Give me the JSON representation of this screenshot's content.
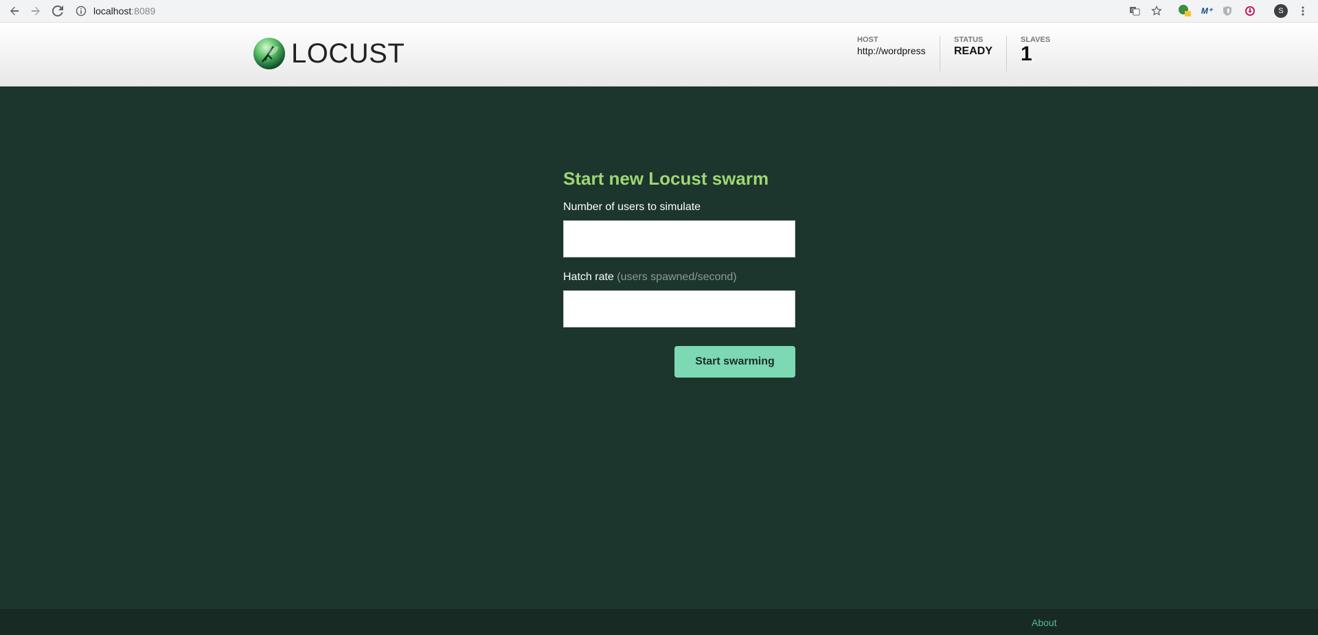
{
  "browser": {
    "url_host": "localhost",
    "url_port": ":8089",
    "profile_initial": "S"
  },
  "header": {
    "brand": "LOCUST",
    "host": {
      "label": "HOST",
      "value": "http://wordpress"
    },
    "status": {
      "label": "STATUS",
      "value": "READY"
    },
    "slaves": {
      "label": "SLAVES",
      "value": "1"
    }
  },
  "form": {
    "title": "Start new Locust swarm",
    "users_label": "Number of users to simulate",
    "users_value": "",
    "hatch_label": "Hatch rate",
    "hatch_hint": "(users spawned/second)",
    "hatch_value": "",
    "submit_label": "Start swarming"
  },
  "footer": {
    "about": "About"
  },
  "colors": {
    "background": "#1c352d",
    "title": "#9fd673",
    "button": "#7dd8b4",
    "footer": "#172a24",
    "link": "#5cb88f"
  }
}
